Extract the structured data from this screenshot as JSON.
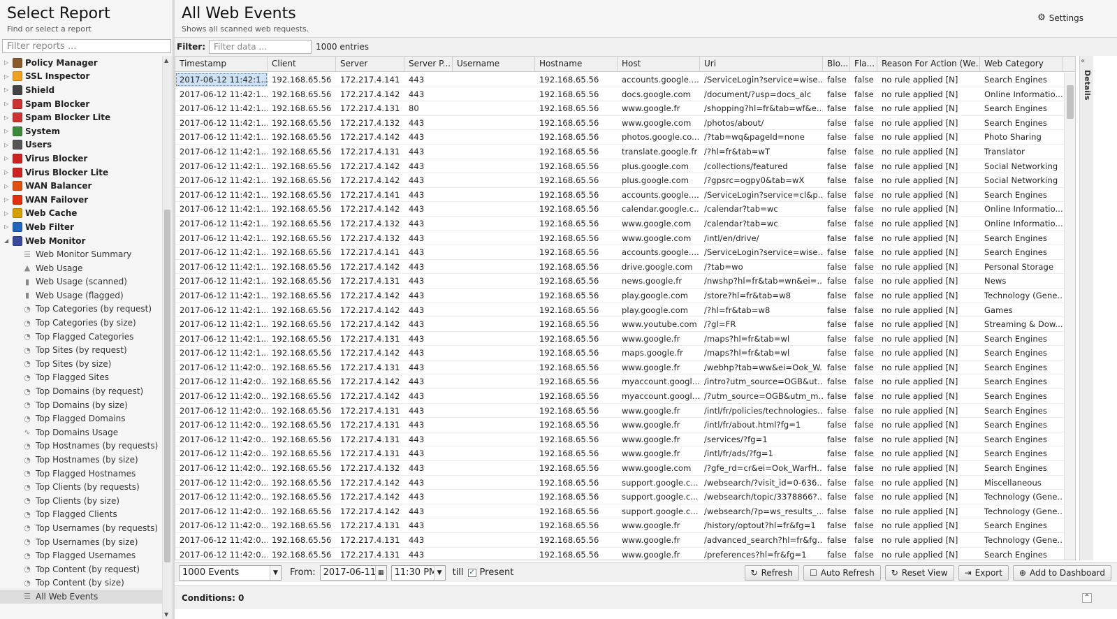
{
  "left": {
    "title": "Select Report",
    "subtitle": "Find or select a report",
    "filter_placeholder": "Filter reports ...",
    "apps": [
      {
        "label": "Policy Manager",
        "color": "#8a5a2b",
        "icon": "policy-icon"
      },
      {
        "label": "SSL Inspector",
        "color": "#f0a020",
        "icon": "ssl-icon"
      },
      {
        "label": "Shield",
        "color": "#444444",
        "icon": "shield-icon"
      },
      {
        "label": "Spam Blocker",
        "color": "#cc3333",
        "icon": "spam-icon"
      },
      {
        "label": "Spam Blocker Lite",
        "color": "#cc3333",
        "icon": "spam-lite-icon"
      },
      {
        "label": "System",
        "color": "#3a8a3a",
        "icon": "system-icon"
      },
      {
        "label": "Users",
        "color": "#555555",
        "icon": "users-icon"
      },
      {
        "label": "Virus Blocker",
        "color": "#cc2222",
        "icon": "virus-icon"
      },
      {
        "label": "Virus Blocker Lite",
        "color": "#cc2222",
        "icon": "virus-lite-icon"
      },
      {
        "label": "WAN Balancer",
        "color": "#e05010",
        "icon": "wan-balancer-icon"
      },
      {
        "label": "WAN Failover",
        "color": "#e03010",
        "icon": "wan-failover-icon"
      },
      {
        "label": "Web Cache",
        "color": "#d4a000",
        "icon": "cache-icon"
      },
      {
        "label": "Web Filter",
        "color": "#2266bb",
        "icon": "filter-icon"
      },
      {
        "label": "Web Monitor",
        "color": "#3a4a9a",
        "icon": "monitor-icon"
      }
    ],
    "reports": [
      {
        "label": "Web Monitor Summary",
        "icon": "list"
      },
      {
        "label": "Web Usage",
        "icon": "area"
      },
      {
        "label": "Web Usage (scanned)",
        "icon": "bar"
      },
      {
        "label": "Web Usage (flagged)",
        "icon": "bar"
      },
      {
        "label": "Top Categories (by request)",
        "icon": "pie"
      },
      {
        "label": "Top Categories (by size)",
        "icon": "pie"
      },
      {
        "label": "Top Flagged Categories",
        "icon": "pie"
      },
      {
        "label": "Top Sites (by request)",
        "icon": "pie"
      },
      {
        "label": "Top Sites (by size)",
        "icon": "pie"
      },
      {
        "label": "Top Flagged Sites",
        "icon": "pie"
      },
      {
        "label": "Top Domains (by request)",
        "icon": "pie"
      },
      {
        "label": "Top Domains (by size)",
        "icon": "pie"
      },
      {
        "label": "Top Flagged Domains",
        "icon": "pie"
      },
      {
        "label": "Top Domains Usage",
        "icon": "line"
      },
      {
        "label": "Top Hostnames (by requests)",
        "icon": "pie"
      },
      {
        "label": "Top Hostnames (by size)",
        "icon": "pie"
      },
      {
        "label": "Top Flagged Hostnames",
        "icon": "pie"
      },
      {
        "label": "Top Clients (by requests)",
        "icon": "pie"
      },
      {
        "label": "Top Clients (by size)",
        "icon": "pie"
      },
      {
        "label": "Top Flagged Clients",
        "icon": "pie"
      },
      {
        "label": "Top Usernames (by requests)",
        "icon": "pie"
      },
      {
        "label": "Top Usernames (by size)",
        "icon": "pie"
      },
      {
        "label": "Top Flagged Usernames",
        "icon": "pie"
      },
      {
        "label": "Top Content (by request)",
        "icon": "pie"
      },
      {
        "label": "Top Content (by size)",
        "icon": "pie"
      },
      {
        "label": "All Web Events",
        "icon": "list",
        "selected": true
      }
    ]
  },
  "main": {
    "title": "All Web Events",
    "subtitle": "Shows all scanned web requests.",
    "settings_label": "Settings",
    "filter_label": "Filter:",
    "filter_placeholder": "Filter data ...",
    "entries": "1000 entries",
    "details_label": "Details",
    "columns": [
      "Timestamp",
      "Client",
      "Server",
      "Server P...",
      "Username",
      "Hostname",
      "Host",
      "Uri",
      "Blo...",
      "Fla...",
      "Reason For Action (We...",
      "Web Category"
    ],
    "rows": [
      [
        "2017-06-12 11:42:1...",
        "192.168.65.56",
        "172.217.4.141",
        "443",
        "",
        "192.168.65.56",
        "accounts.google....",
        "/ServiceLogin?service=wise...",
        "false",
        "false",
        "no rule applied [N]",
        "Search Engines"
      ],
      [
        "2017-06-12 11:42:1...",
        "192.168.65.56",
        "172.217.4.142",
        "443",
        "",
        "192.168.65.56",
        "docs.google.com",
        "/document/?usp=docs_alc",
        "false",
        "false",
        "no rule applied [N]",
        "Online Informatio..."
      ],
      [
        "2017-06-12 11:42:1...",
        "192.168.65.56",
        "172.217.4.131",
        "80",
        "",
        "192.168.65.56",
        "www.google.fr",
        "/shopping?hl=fr&tab=wf&e...",
        "false",
        "false",
        "no rule applied [N]",
        "Search Engines"
      ],
      [
        "2017-06-12 11:42:1...",
        "192.168.65.56",
        "172.217.4.132",
        "443",
        "",
        "192.168.65.56",
        "www.google.com",
        "/photos/about/",
        "false",
        "false",
        "no rule applied [N]",
        "Search Engines"
      ],
      [
        "2017-06-12 11:42:1...",
        "192.168.65.56",
        "172.217.4.142",
        "443",
        "",
        "192.168.65.56",
        "photos.google.co...",
        "/?tab=wq&pageId=none",
        "false",
        "false",
        "no rule applied [N]",
        "Photo Sharing"
      ],
      [
        "2017-06-12 11:42:1...",
        "192.168.65.56",
        "172.217.4.131",
        "443",
        "",
        "192.168.65.56",
        "translate.google.fr",
        "/?hl=fr&tab=wT",
        "false",
        "false",
        "no rule applied [N]",
        "Translator"
      ],
      [
        "2017-06-12 11:42:1...",
        "192.168.65.56",
        "172.217.4.142",
        "443",
        "",
        "192.168.65.56",
        "plus.google.com",
        "/collections/featured",
        "false",
        "false",
        "no rule applied [N]",
        "Social Networking"
      ],
      [
        "2017-06-12 11:42:1...",
        "192.168.65.56",
        "172.217.4.142",
        "443",
        "",
        "192.168.65.56",
        "plus.google.com",
        "/?gpsrc=ogpy0&tab=wX",
        "false",
        "false",
        "no rule applied [N]",
        "Social Networking"
      ],
      [
        "2017-06-12 11:42:1...",
        "192.168.65.56",
        "172.217.4.141",
        "443",
        "",
        "192.168.65.56",
        "accounts.google....",
        "/ServiceLogin?service=cl&p...",
        "false",
        "false",
        "no rule applied [N]",
        "Search Engines"
      ],
      [
        "2017-06-12 11:42:1...",
        "192.168.65.56",
        "172.217.4.142",
        "443",
        "",
        "192.168.65.56",
        "calendar.google.c...",
        "/calendar?tab=wc",
        "false",
        "false",
        "no rule applied [N]",
        "Online Informatio..."
      ],
      [
        "2017-06-12 11:42:1...",
        "192.168.65.56",
        "172.217.4.132",
        "443",
        "",
        "192.168.65.56",
        "www.google.com",
        "/calendar?tab=wc",
        "false",
        "false",
        "no rule applied [N]",
        "Online Informatio..."
      ],
      [
        "2017-06-12 11:42:1...",
        "192.168.65.56",
        "172.217.4.132",
        "443",
        "",
        "192.168.65.56",
        "www.google.com",
        "/intl/en/drive/",
        "false",
        "false",
        "no rule applied [N]",
        "Search Engines"
      ],
      [
        "2017-06-12 11:42:1...",
        "192.168.65.56",
        "172.217.4.141",
        "443",
        "",
        "192.168.65.56",
        "accounts.google....",
        "/ServiceLogin?service=wise...",
        "false",
        "false",
        "no rule applied [N]",
        "Search Engines"
      ],
      [
        "2017-06-12 11:42:1...",
        "192.168.65.56",
        "172.217.4.142",
        "443",
        "",
        "192.168.65.56",
        "drive.google.com",
        "/?tab=wo",
        "false",
        "false",
        "no rule applied [N]",
        "Personal Storage"
      ],
      [
        "2017-06-12 11:42:1...",
        "192.168.65.56",
        "172.217.4.131",
        "443",
        "",
        "192.168.65.56",
        "news.google.fr",
        "/nwshp?hl=fr&tab=wn&ei=...",
        "false",
        "false",
        "no rule applied [N]",
        "News"
      ],
      [
        "2017-06-12 11:42:1...",
        "192.168.65.56",
        "172.217.4.142",
        "443",
        "",
        "192.168.65.56",
        "play.google.com",
        "/store?hl=fr&tab=w8",
        "false",
        "false",
        "no rule applied [N]",
        "Technology (Gene..."
      ],
      [
        "2017-06-12 11:42:1...",
        "192.168.65.56",
        "172.217.4.142",
        "443",
        "",
        "192.168.65.56",
        "play.google.com",
        "/?hl=fr&tab=w8",
        "false",
        "false",
        "no rule applied [N]",
        "Games"
      ],
      [
        "2017-06-12 11:42:1...",
        "192.168.65.56",
        "172.217.4.142",
        "443",
        "",
        "192.168.65.56",
        "www.youtube.com",
        "/?gl=FR",
        "false",
        "false",
        "no rule applied [N]",
        "Streaming & Dow..."
      ],
      [
        "2017-06-12 11:42:1...",
        "192.168.65.56",
        "172.217.4.131",
        "443",
        "",
        "192.168.65.56",
        "www.google.fr",
        "/maps?hl=fr&tab=wl",
        "false",
        "false",
        "no rule applied [N]",
        "Search Engines"
      ],
      [
        "2017-06-12 11:42:1...",
        "192.168.65.56",
        "172.217.4.142",
        "443",
        "",
        "192.168.65.56",
        "maps.google.fr",
        "/maps?hl=fr&tab=wl",
        "false",
        "false",
        "no rule applied [N]",
        "Search Engines"
      ],
      [
        "2017-06-12 11:42:0...",
        "192.168.65.56",
        "172.217.4.131",
        "443",
        "",
        "192.168.65.56",
        "www.google.fr",
        "/webhp?tab=ww&ei=Ook_W...",
        "false",
        "false",
        "no rule applied [N]",
        "Search Engines"
      ],
      [
        "2017-06-12 11:42:0...",
        "192.168.65.56",
        "172.217.4.142",
        "443",
        "",
        "192.168.65.56",
        "myaccount.googl...",
        "/intro?utm_source=OGB&ut...",
        "false",
        "false",
        "no rule applied [N]",
        "Search Engines"
      ],
      [
        "2017-06-12 11:42:0...",
        "192.168.65.56",
        "172.217.4.142",
        "443",
        "",
        "192.168.65.56",
        "myaccount.googl...",
        "/?utm_source=OGB&utm_m...",
        "false",
        "false",
        "no rule applied [N]",
        "Search Engines"
      ],
      [
        "2017-06-12 11:42:0...",
        "192.168.65.56",
        "172.217.4.131",
        "443",
        "",
        "192.168.65.56",
        "www.google.fr",
        "/intl/fr/policies/technologies...",
        "false",
        "false",
        "no rule applied [N]",
        "Search Engines"
      ],
      [
        "2017-06-12 11:42:0...",
        "192.168.65.56",
        "172.217.4.131",
        "443",
        "",
        "192.168.65.56",
        "www.google.fr",
        "/intl/fr/about.html?fg=1",
        "false",
        "false",
        "no rule applied [N]",
        "Search Engines"
      ],
      [
        "2017-06-12 11:42:0...",
        "192.168.65.56",
        "172.217.4.131",
        "443",
        "",
        "192.168.65.56",
        "www.google.fr",
        "/services/?fg=1",
        "false",
        "false",
        "no rule applied [N]",
        "Search Engines"
      ],
      [
        "2017-06-12 11:42:0...",
        "192.168.65.56",
        "172.217.4.131",
        "443",
        "",
        "192.168.65.56",
        "www.google.fr",
        "/intl/fr/ads/?fg=1",
        "false",
        "false",
        "no rule applied [N]",
        "Search Engines"
      ],
      [
        "2017-06-12 11:42:0...",
        "192.168.65.56",
        "172.217.4.132",
        "443",
        "",
        "192.168.65.56",
        "www.google.com",
        "/?gfe_rd=cr&ei=Ook_WarfH...",
        "false",
        "false",
        "no rule applied [N]",
        "Search Engines"
      ],
      [
        "2017-06-12 11:42:0...",
        "192.168.65.56",
        "172.217.4.142",
        "443",
        "",
        "192.168.65.56",
        "support.google.c...",
        "/websearch/?visit_id=0-636...",
        "false",
        "false",
        "no rule applied [N]",
        "Miscellaneous"
      ],
      [
        "2017-06-12 11:42:0...",
        "192.168.65.56",
        "172.217.4.142",
        "443",
        "",
        "192.168.65.56",
        "support.google.c...",
        "/websearch/topic/3378866?...",
        "false",
        "false",
        "no rule applied [N]",
        "Technology (Gene..."
      ],
      [
        "2017-06-12 11:42:0...",
        "192.168.65.56",
        "172.217.4.142",
        "443",
        "",
        "192.168.65.56",
        "support.google.c...",
        "/websearch/?p=ws_results_...",
        "false",
        "false",
        "no rule applied [N]",
        "Technology (Gene..."
      ],
      [
        "2017-06-12 11:42:0...",
        "192.168.65.56",
        "172.217.4.131",
        "443",
        "",
        "192.168.65.56",
        "www.google.fr",
        "/history/optout?hl=fr&fg=1",
        "false",
        "false",
        "no rule applied [N]",
        "Search Engines"
      ],
      [
        "2017-06-12 11:42:0...",
        "192.168.65.56",
        "172.217.4.131",
        "443",
        "",
        "192.168.65.56",
        "www.google.fr",
        "/advanced_search?hl=fr&fg...",
        "false",
        "false",
        "no rule applied [N]",
        "Technology (Gene..."
      ],
      [
        "2017-06-12 11:42:0...",
        "192.168.65.56",
        "172.217.4.131",
        "443",
        "",
        "192.168.65.56",
        "www.google.fr",
        "/preferences?hl=fr&fg=1",
        "false",
        "false",
        "no rule applied [N]",
        "Search Engines"
      ]
    ]
  },
  "bottom": {
    "limit_value": "1000 Events",
    "from_label": "From:",
    "from_date": "2017-06-11",
    "from_time": "11:30 PM",
    "till_label": "till",
    "present_label": "Present",
    "refresh": "Refresh",
    "auto_refresh": "Auto Refresh",
    "reset_view": "Reset View",
    "export": "Export",
    "add_dashboard": "Add to Dashboard",
    "conditions": "Conditions: 0"
  }
}
